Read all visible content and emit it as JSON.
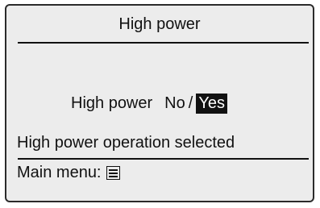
{
  "screen": {
    "title": "High power",
    "setting": {
      "label": "High power",
      "option_no": "No",
      "separator": "/",
      "option_yes": "Yes",
      "selected": "Yes"
    },
    "status": "High power operation selected",
    "footer": {
      "label": "Main menu:",
      "icon": "menu-icon"
    }
  }
}
